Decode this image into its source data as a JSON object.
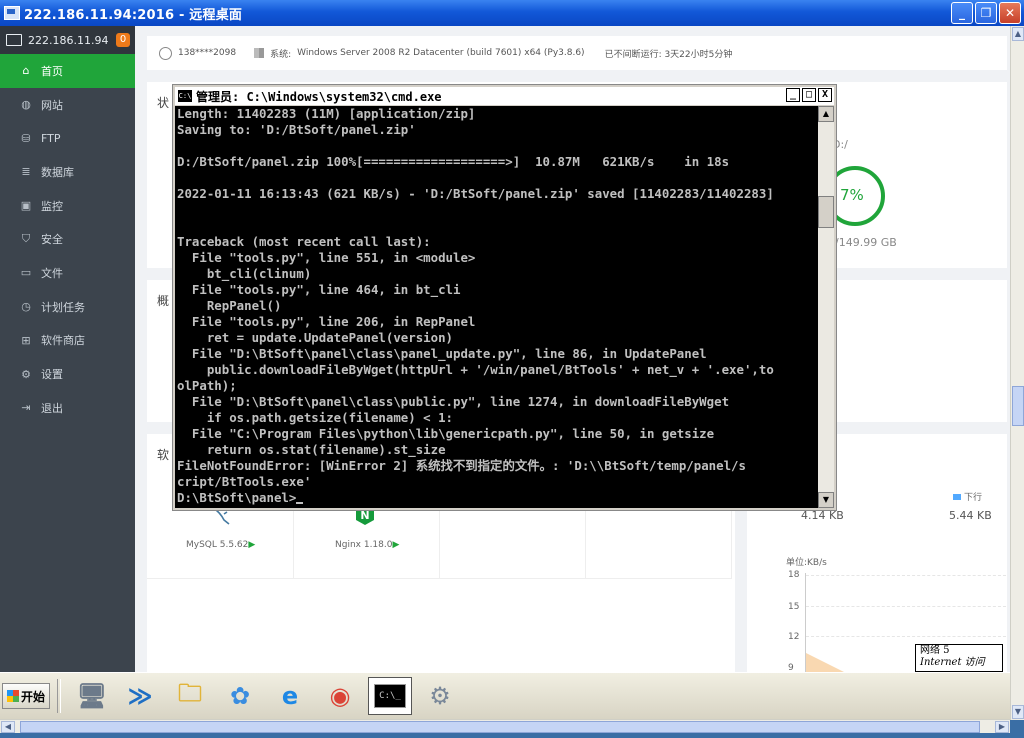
{
  "rdp": {
    "title": "222.186.11.94:2016 - 远程桌面",
    "btn_minimize": "_",
    "btn_restore": "❐",
    "btn_close": "✕"
  },
  "sidebar": {
    "host": "222.186.11.94",
    "badge": "0",
    "items": [
      {
        "label": "首页",
        "icon": "home-icon",
        "glyph": "⌂"
      },
      {
        "label": "网站",
        "icon": "globe-icon",
        "glyph": "◍"
      },
      {
        "label": "FTP",
        "icon": "ftp-icon",
        "glyph": "⛁"
      },
      {
        "label": "数据库",
        "icon": "database-icon",
        "glyph": "≣"
      },
      {
        "label": "监控",
        "icon": "monitor-icon",
        "glyph": "▣"
      },
      {
        "label": "安全",
        "icon": "shield-icon",
        "glyph": "⛉"
      },
      {
        "label": "文件",
        "icon": "folder-icon",
        "glyph": "▭"
      },
      {
        "label": "计划任务",
        "icon": "clock-icon",
        "glyph": "◷"
      },
      {
        "label": "软件商店",
        "icon": "apps-icon",
        "glyph": "⊞"
      },
      {
        "label": "设置",
        "icon": "gear-icon",
        "glyph": "⚙"
      },
      {
        "label": "退出",
        "icon": "logout-icon",
        "glyph": "⇥"
      }
    ]
  },
  "topinfo": {
    "user": "138****2098",
    "system_label": "系统:",
    "system_value": "Windows Server 2008 R2 Datacenter (build 7601) x64 (Py3.8.6)",
    "uptime": "已不间断运行: 3天22小时5分钟"
  },
  "cards": {
    "status_title": "状",
    "overview_title": "概",
    "software_title": "软"
  },
  "disk": {
    "label": "D:/",
    "percent": "7%",
    "size": "/149.99 GB"
  },
  "software": [
    {
      "name": "MySQL 5.5.62",
      "play": "▶"
    },
    {
      "name": "Nginx 1.18.0",
      "play": "▶"
    }
  ],
  "network": {
    "legend_down": "下行",
    "up_value": "4.14 KB",
    "down_value": "5.44 KB",
    "unit": "单位:KB/s",
    "yticks": [
      "18",
      "15",
      "12",
      "9"
    ],
    "tooltip_line1": "网络  5",
    "tooltip_line2": "Internet 访问"
  },
  "cmd": {
    "title": "管理员: C:\\Windows\\system32\\cmd.exe",
    "icon_text": "C:\\",
    "btn_min": "_",
    "btn_max": "□",
    "btn_close": "X",
    "output": "Length: 11402283 (11M) [application/zip]\nSaving to: 'D:/BtSoft/panel.zip'\n\nD:/BtSoft/panel.zip 100%[===================>]  10.87M   621KB/s    in 18s\n\n2022-01-11 16:13:43 (621 KB/s) - 'D:/BtSoft/panel.zip' saved [11402283/11402283]\n\n\nTraceback (most recent call last):\n  File \"tools.py\", line 551, in <module>\n    bt_cli(clinum)\n  File \"tools.py\", line 464, in bt_cli\n    RepPanel()\n  File \"tools.py\", line 206, in RepPanel\n    ret = update.UpdatePanel(version)\n  File \"D:\\BtSoft\\panel\\class\\panel_update.py\", line 86, in UpdatePanel\n    public.downloadFileByWget(httpUrl + '/win/panel/BtTools' + net_v + '.exe',to\nolPath);\n  File \"D:\\BtSoft\\panel\\class\\public.py\", line 1274, in downloadFileByWget\n    if os.path.getsize(filename) < 1:\n  File \"C:\\Program Files\\python\\lib\\genericpath.py\", line 50, in getsize\n    return os.stat(filename).st_size\nFileNotFoundError: [WinError 2] 系统找不到指定的文件。: 'D:\\\\BtSoft/temp/panel/s\ncript/BtTools.exe'",
    "prompt": "D:\\BtSoft\\panel>"
  },
  "taskbar": {
    "start_label": "开始",
    "apps": [
      {
        "name": "server-manager-icon",
        "glyph": "🖥"
      },
      {
        "name": "powershell-icon",
        "glyph": "≫"
      },
      {
        "name": "explorer-icon",
        "glyph": "🗀"
      },
      {
        "name": "baidu-netdisk-icon",
        "glyph": "✿"
      },
      {
        "name": "ie-icon",
        "glyph": "e"
      },
      {
        "name": "chrome-icon",
        "glyph": "◉"
      },
      {
        "name": "cmd-icon",
        "glyph": "C:\\_"
      },
      {
        "name": "settings-tool-icon",
        "glyph": "⚙"
      }
    ]
  },
  "scroll": {
    "up": "▲",
    "down": "▼",
    "left": "◀",
    "right": "▶"
  }
}
